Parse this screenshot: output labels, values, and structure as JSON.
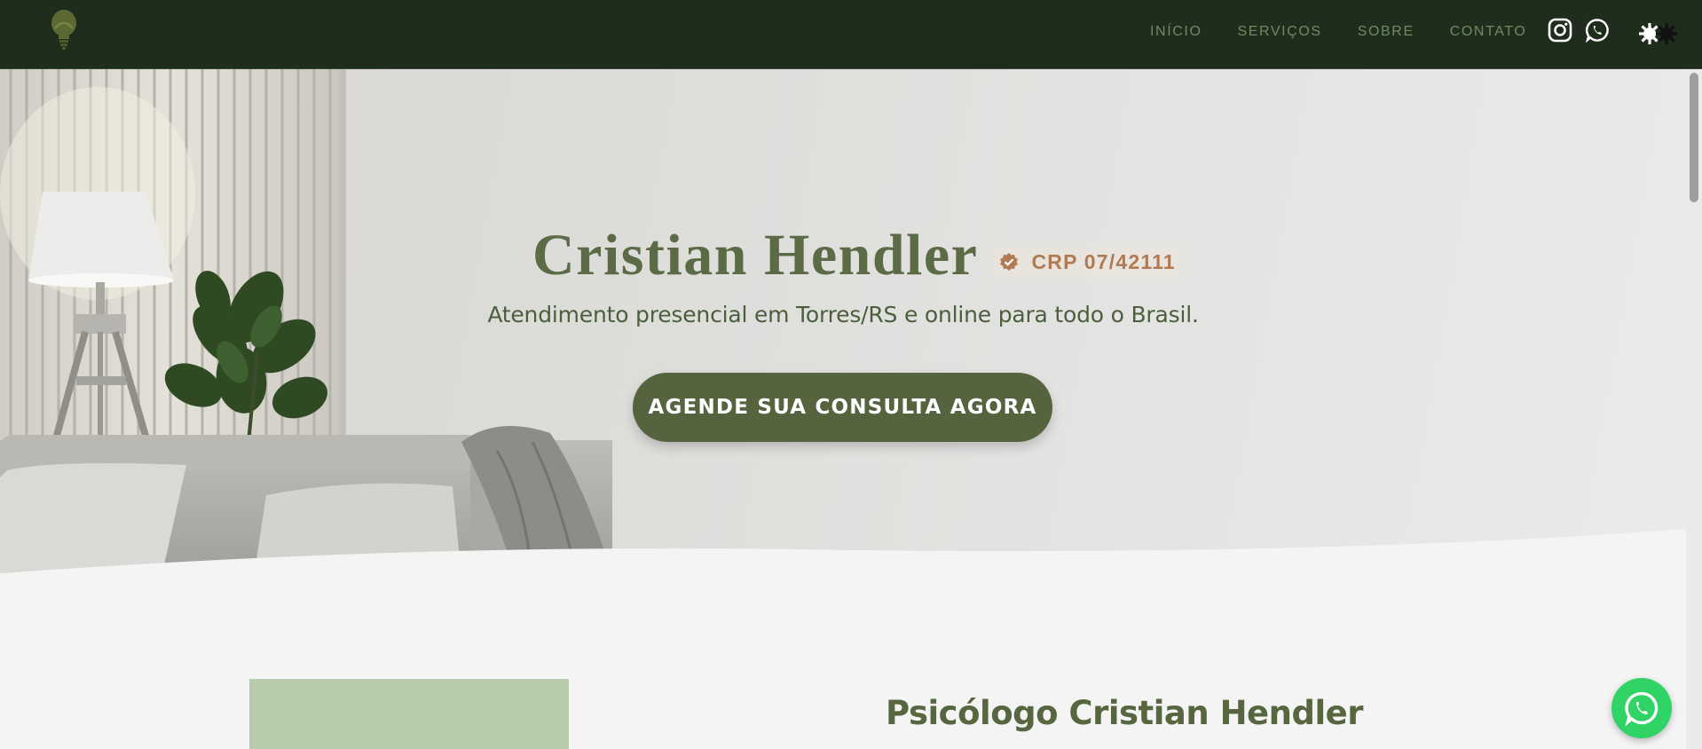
{
  "nav": {
    "logo_icon": "lightbulb-logo-icon",
    "links": [
      {
        "label": "INÍCIO"
      },
      {
        "label": "SERVIÇOS"
      },
      {
        "label": "SOBRE"
      },
      {
        "label": "CONTATO"
      }
    ],
    "social": {
      "instagram_icon": "instagram-icon",
      "whatsapp_icon": "whatsapp-icon"
    },
    "theme_toggle_icon": "theme-toggle-icon"
  },
  "hero": {
    "name": "Cristian Hendler",
    "crp_icon": "verified-badge-icon",
    "crp": "CRP 07/42111",
    "subtitle": "Atendimento presencial em Torres/RS e online para todo o Brasil.",
    "cta_label": "AGENDE SUA CONSULTA AGORA"
  },
  "about": {
    "title": "Psicólogo Cristian Hendler"
  },
  "floating": {
    "whatsapp_icon": "whatsapp-float-icon"
  },
  "colors": {
    "nav_bg": "#1f2e1c",
    "accent_green": "#55633f",
    "title_green": "#5a6b46",
    "crp_color": "#b07a52",
    "whatsapp_green": "#2fd366",
    "about_image_bg": "#b6ccaa"
  }
}
